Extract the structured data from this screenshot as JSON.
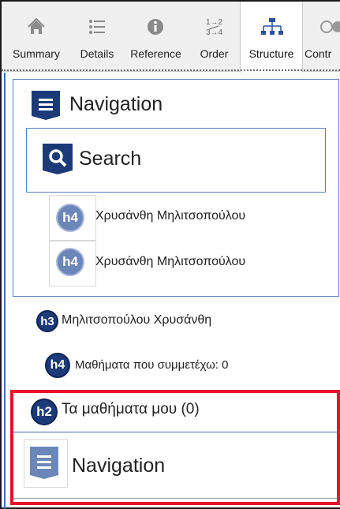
{
  "tabs": [
    {
      "label": "Summary",
      "icon": "home-icon"
    },
    {
      "label": "Details",
      "icon": "list-icon"
    },
    {
      "label": "Reference",
      "icon": "info-icon"
    },
    {
      "label": "Order",
      "icon": "order-icon",
      "icon_text": "1⇢2\n3⇢4"
    },
    {
      "label": "Structure",
      "icon": "hierarchy-icon",
      "active": true
    },
    {
      "label": "Contr",
      "icon": "contrast-icon"
    }
  ],
  "structure": {
    "nav1": {
      "label": "Navigation"
    },
    "search": {
      "label": "Search"
    },
    "h4_a": {
      "level": "h4",
      "text": "Χρυσάνθη Μηλιτσοπούλου"
    },
    "h4_b": {
      "level": "h4",
      "text": "Χρυσάνθη Μηλιτσοπούλου"
    },
    "h3": {
      "level": "h3",
      "text": "Μηλιτσοπούλου Χρυσάνθη"
    },
    "h4_c": {
      "level": "h4",
      "text": "Μαθήματα που συμμετέχω: 0"
    },
    "h2": {
      "level": "h2",
      "text": "Τα μαθήματα μου  (0)"
    },
    "nav2": {
      "label": "Navigation"
    }
  },
  "colors": {
    "highlight": "#e8102a",
    "badge_dark": "#1c3a78",
    "badge_light": "#6b86b8",
    "landmark_border": "#5b7fbf"
  }
}
